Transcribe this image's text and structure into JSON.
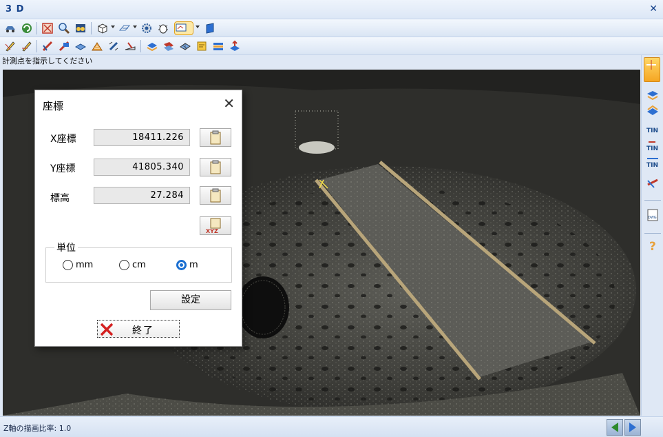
{
  "window": {
    "title": "3 D",
    "close_icon": "close-icon"
  },
  "toolbar1": {
    "icons": [
      "car-icon",
      "refresh-icon",
      "zoom-extent-icon",
      "magnifier-icon",
      "binoculars-icon",
      "cube-icon",
      "plane-icon",
      "gear-icon",
      "bug-icon",
      "measure-point-icon",
      "book-icon"
    ],
    "selected": "measure-point-icon"
  },
  "toolbar2": {
    "icons": [
      "pencil-line-icon",
      "pencil-erase-icon",
      "section-red-icon",
      "section-blue-icon",
      "layer-icon",
      "contour-icon",
      "pencil-edit-icon",
      "ruler-icon",
      "layers-blue-icon",
      "sheets-icon",
      "grid-icon",
      "folder-icon",
      "layers-stack-icon",
      "export-icon"
    ]
  },
  "instruction": "計測点を指示してください",
  "dialog": {
    "title": "座標",
    "x_label": "X座標",
    "x_value": "18411.226",
    "y_label": "Y座標",
    "y_value": "41805.340",
    "z_label": "標高",
    "z_value": "27.284",
    "unit_group_label": "単位",
    "unit_options": [
      "mm",
      "cm",
      "m"
    ],
    "unit_selected": "m",
    "set_label": "設定",
    "exit_label": "終了"
  },
  "status": {
    "text": "Z軸の描画比率: 1.0"
  }
}
